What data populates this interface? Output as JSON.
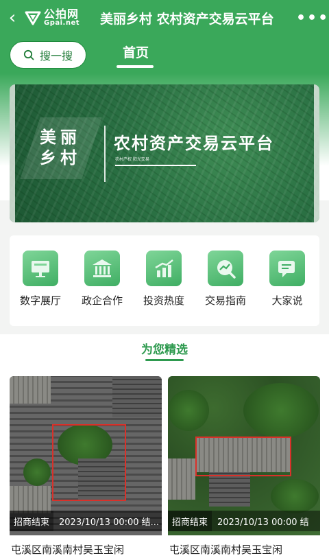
{
  "topbar": {
    "logo_cn": "公拍网",
    "logo_en": "Gpai.net",
    "title": "美丽乡村 农村资产交易云平台"
  },
  "nav": {
    "search_label": "搜一搜",
    "home_tab": "首页"
  },
  "banner": {
    "slogan": "美丽乡村",
    "title": "农村资产交易云平台",
    "subtitle": "农村产权  阳光交易"
  },
  "menu": {
    "items": [
      {
        "label": "数字展厅",
        "icon": "monitor-icon"
      },
      {
        "label": "政企合作",
        "icon": "government-building-icon"
      },
      {
        "label": "投资热度",
        "icon": "bar-chart-icon"
      },
      {
        "label": "交易指南",
        "icon": "chart-magnifier-icon"
      },
      {
        "label": "大家说",
        "icon": "chat-bubble-icon"
      }
    ]
  },
  "picks": {
    "title": "为您精选",
    "cards": [
      {
        "status": "招商结束",
        "date": "2023/10/13 00:00 结...",
        "title": "屯溪区南溪南村吴玉宝闲"
      },
      {
        "status": "招商结束",
        "date": "2023/10/13 00:00 结",
        "title": "屯溪区南溪南村吴玉宝闲"
      }
    ]
  },
  "colors": {
    "brand_green": "#3aa85a",
    "accent_green": "#2e9a4f",
    "outline_red": "#d9312a"
  }
}
